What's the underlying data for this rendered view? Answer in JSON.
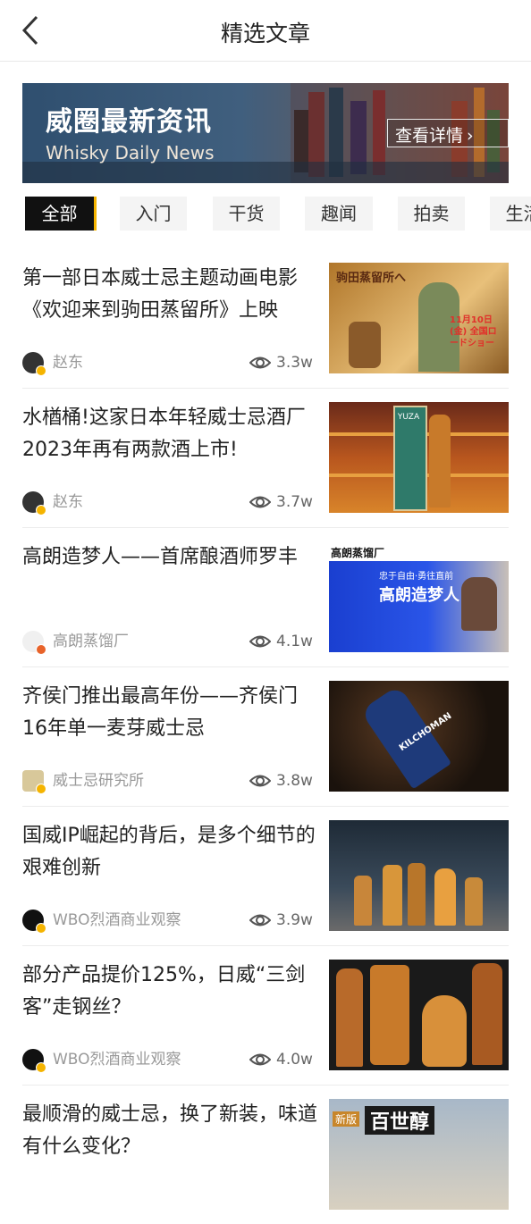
{
  "header": {
    "title": "精选文章"
  },
  "banner": {
    "title": "威圈最新资讯",
    "subtitle": "Whisky Daily News",
    "button_label": "查看详情"
  },
  "tabs": [
    "全部",
    "入门",
    "干货",
    "趣闻",
    "拍卖",
    "生活"
  ],
  "active_tab": "全部",
  "articles": [
    {
      "title": "第一部日本威士忌主题动画电影《欢迎来到驹田蒸留所》上映",
      "author": "赵东",
      "views": "3.3w",
      "thumb_label": "驹田蒸留所へ",
      "thumb_sub": "11月10日(金) 全国ロードショー"
    },
    {
      "title": "水楢桶!这家日本年轻威士忌酒厂2023年再有两款酒上市!",
      "author": "赵东",
      "views": "3.7w",
      "thumb_label": "YUZA"
    },
    {
      "title": "高朗造梦人——首席酿酒师罗丰",
      "author": "高朗蒸馏厂",
      "views": "4.1w",
      "thumb_label": "高朗蒸馏厂",
      "thumb_headline": "高朗造梦人",
      "thumb_tagline": "忠于自由·勇往直前"
    },
    {
      "title": "齐侯门推出最高年份——齐侯门16年单一麦芽威士忌",
      "author": "威士忌研究所",
      "views": "3.8w",
      "thumb_label": "KILCHOMAN"
    },
    {
      "title": "国威IP崛起的背后，是多个细节的艰难创新",
      "author": "WBO烈酒商业观察",
      "views": "3.9w"
    },
    {
      "title": "部分产品提价125%，日威“三剑客”走钢丝？",
      "author": "WBO烈酒商业观察",
      "views": "4.0w"
    },
    {
      "title": "最顺滑的威士忌，换了新装，味道有什么变化？",
      "author": "",
      "views": "",
      "thumb_label": "百世醇",
      "thumb_tag": "新版"
    }
  ],
  "colors": {
    "accent": "#f5b400",
    "active_tab_bg": "#111111"
  }
}
